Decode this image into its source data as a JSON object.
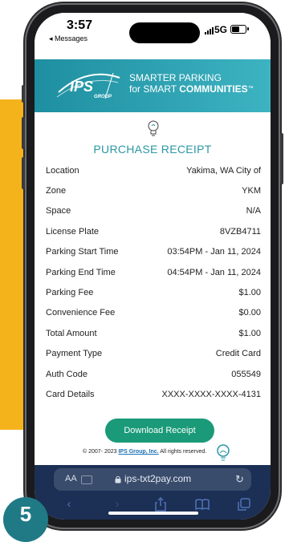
{
  "status_bar": {
    "time": "3:57",
    "back_app": "◂ Messages",
    "network": "5G"
  },
  "brand": {
    "logo_text": "IPS",
    "logo_sub": "GROUP",
    "tagline_line1_a": "SMARTER ",
    "tagline_line1_b": "PARKING",
    "tagline_line2_a": "for SMART ",
    "tagline_line2_b": "COMMUNITIES",
    "tagline_mark": "™"
  },
  "receipt": {
    "title": "PURCHASE RECEIPT",
    "rows": [
      {
        "label": "Location",
        "value": "Yakima, WA City of"
      },
      {
        "label": "Zone",
        "value": "YKM"
      },
      {
        "label": "Space",
        "value": "N/A"
      },
      {
        "label": "License Plate",
        "value": "8VZB4711"
      },
      {
        "label": "Parking Start Time",
        "value": "03:54PM - Jan 11, 2024"
      },
      {
        "label": "Parking End Time",
        "value": "04:54PM - Jan 11, 2024"
      },
      {
        "label": "Parking Fee",
        "value": "$1.00"
      },
      {
        "label": "Convenience Fee",
        "value": "$0.00"
      },
      {
        "label": "Total Amount",
        "value": "$1.00"
      },
      {
        "label": "Payment Type",
        "value": "Credit Card"
      },
      {
        "label": "Auth Code",
        "value": "055549"
      },
      {
        "label": "Card Details",
        "value": "XXXX-XXXX-XXXX-4131"
      }
    ],
    "download_label": "Download Receipt",
    "copyright_prefix": "© 2007- 2023 ",
    "copyright_link": "IPS Group, Inc.",
    "copyright_suffix": " All rights reserved."
  },
  "browser": {
    "text_size": "AA",
    "url": "ips-txt2pay.com"
  },
  "step_number": "5",
  "colors": {
    "accent_yellow": "#F5B31B",
    "brand_teal": "#2a97a4",
    "button_green": "#1a9a78",
    "browser_navy": "#1c2f54",
    "badge_teal": "#1F7A86"
  }
}
